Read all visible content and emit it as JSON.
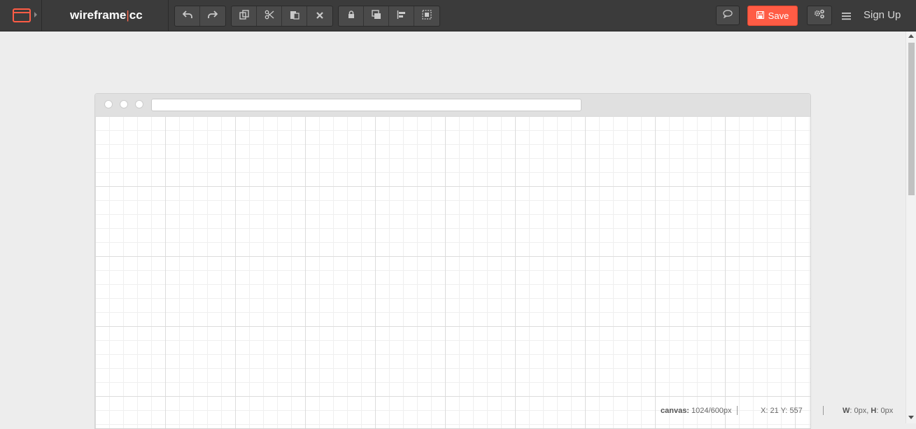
{
  "app": {
    "brand_main": "wireframe",
    "brand_sep": "|",
    "brand_suffix": "cc",
    "accent_color": "#ff5c45"
  },
  "toolbar": {
    "history_buttons": [
      "undo-icon",
      "redo-icon"
    ],
    "edit_buttons": [
      "duplicate-icon",
      "cut-icon",
      "paste-icon",
      "delete-icon"
    ],
    "arrange_buttons": [
      "lock-icon",
      "bring-front-icon",
      "align-icon",
      "group-icon"
    ],
    "comment_icon": "speech-bubble-icon",
    "save_label": "Save",
    "save_icon": "floppy-disk-icon",
    "settings_icon": "gears-icon",
    "menu_icon": "hamburger-icon",
    "signup_label": "Sign Up"
  },
  "canvas": {
    "url_value": ""
  },
  "status": {
    "canvas_label": "canvas:",
    "canvas_value": "1024/600px",
    "x_label": "X:",
    "x_value": "21",
    "y_label": "Y:",
    "y_value": "557",
    "w_label": "W",
    "w_value": "0px,",
    "h_label": "H",
    "h_value": "0px"
  }
}
